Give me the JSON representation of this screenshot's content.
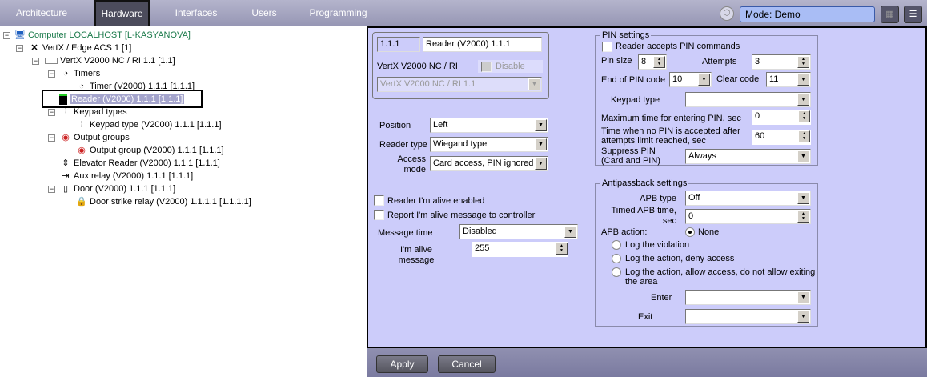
{
  "topbar": {
    "tabs": [
      "Architecture",
      "Hardware",
      "Interfaces",
      "Users",
      "Programming"
    ],
    "active_tab": "Hardware",
    "mode": "Mode: Demo"
  },
  "tree": {
    "items": [
      "Computer LOCALHOST [L-KASYANOVA]",
      "VertX / Edge ACS 1 [1]",
      "VertX V2000 NC / RI 1.1 [1.1]",
      "Timers",
      "Timer (V2000) 1.1.1 [1.1.1]",
      "Reader (V2000) 1.1.1 [1.1.1]",
      "Keypad types",
      "Keypad type (V2000) 1.1.1 [1.1.1]",
      "Output groups",
      "Output group (V2000) 1.1.1 [1.1.1]",
      "Elevator Reader (V2000) 1.1.1 [1.1.1]",
      "Aux relay (V2000) 1.1.1 [1.1.1]",
      "Door (V2000) 1.1.1 [1.1.1]",
      "Door strike relay (V2000) 1.1.1.1 [1.1.1.1]"
    ],
    "selected": "Reader (V2000) 1.1.1 [1.1.1]"
  },
  "header": {
    "id": "1.1.1",
    "name": "Reader (V2000) 1.1.1",
    "parent_label": "VertX V2000 NC / RI",
    "disable_label": "Disable",
    "parent_value": "VertX V2000 NC / RI 1.1"
  },
  "reader": {
    "position_label": "Position",
    "position": "Left",
    "type_label": "Reader type",
    "type": "Wiegand type",
    "access_label_1": "Access",
    "access_label_2": "mode",
    "access": "Card access, PIN ignored",
    "alive_enabled": "Reader I'm alive enabled",
    "report_alive": "Report I'm alive message to controller",
    "message_time_label": "Message time",
    "message_time": "Disabled",
    "alive_msg_label_1": "I'm alive",
    "alive_msg_label_2": "message",
    "alive_msg": "255"
  },
  "pin": {
    "title": "PIN settings",
    "accepts": "Reader accepts PIN commands",
    "pin_size_label": "Pin size",
    "pin_size": "8",
    "attempts_label": "Attempts",
    "attempts": "3",
    "end_label": "End of PIN code",
    "end": "10",
    "clear_label": "Clear code",
    "clear": "11",
    "keypad_label": "Keypad type",
    "keypad": "",
    "max_time_label": "Maximum time for entering PIN, sec",
    "max_time": "0",
    "lock_label_1": "Time when no PIN is accepted after",
    "lock_label_2": "attempts limit reached, sec",
    "lock_time": "60",
    "suppress_label_1": "Suppress PIN",
    "suppress_label_2": "(Card and PIN)",
    "suppress": "Always"
  },
  "apb": {
    "title": "Antipassback settings",
    "type_label": "APB type",
    "type": "Off",
    "timed_label_1": "Timed APB time,",
    "timed_label_2": "sec",
    "timed": "0",
    "action_label": "APB action:",
    "actions": [
      "None",
      "Log the violation",
      "Log the action, deny access",
      "Log the action, allow access, do not allow exiting",
      "the area"
    ],
    "enter_label": "Enter",
    "enter": "",
    "exit_label": "Exit",
    "exit": ""
  },
  "footer": {
    "apply": "Apply",
    "cancel": "Cancel"
  }
}
